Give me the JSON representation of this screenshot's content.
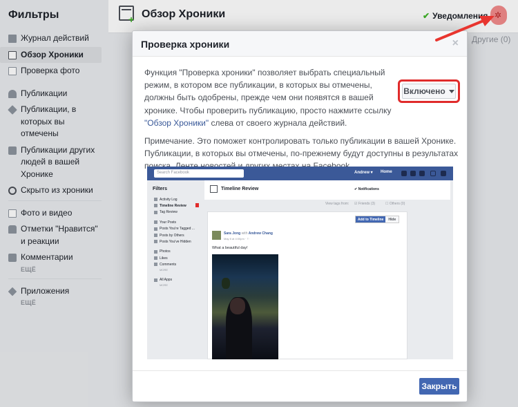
{
  "sidebar": {
    "title": "Фильтры",
    "items": [
      {
        "label": "Журнал действий",
        "icon": "journal-icon",
        "color": "#8d949e"
      },
      {
        "label": "Обзор Хроники",
        "icon": "timeline-review-icon",
        "color": "#4b4f56",
        "active": true
      },
      {
        "label": "Проверка фото",
        "icon": "photo-review-icon",
        "color": "#8d949e"
      },
      {
        "label": "Публикации",
        "icon": "person-icon",
        "color": "#8d949e"
      },
      {
        "label": "Публикации, в которых вы отмечены",
        "icon": "tag-icon",
        "color": "#8d949e"
      },
      {
        "label": "Публикации других людей в вашей Хронике",
        "icon": "comment-icon",
        "color": "#8d949e"
      },
      {
        "label": "Скрыто из хроники",
        "icon": "hidden-icon",
        "color": "#4b4f56"
      },
      {
        "label": "Фото и видео",
        "icon": "photos-icon",
        "color": "#8d949e"
      },
      {
        "label": "Отметки \"Нравится\" и реакции",
        "icon": "like-icon",
        "color": "#8d949e"
      },
      {
        "label": "Комментарии",
        "icon": "comments-icon",
        "color": "#8d949e"
      },
      {
        "label": "Приложения",
        "icon": "apps-icon",
        "color": "#8d949e"
      }
    ],
    "more_label": "ЕЩЁ"
  },
  "header": {
    "title": "Обзор Хроники",
    "notifications_label": "Уведомления",
    "other_label": "Другие (0)"
  },
  "dialog": {
    "title": "Проверка хроники",
    "close_glyph": "×",
    "paragraph1_before_link": "Функция \"Проверка хроники\" позволяет выбрать специальный режим, в котором все публикации, в которых вы отмечены, должны быть одобрены, прежде чем они появятся в вашей хронике. Чтобы проверить публикацию, просто нажмите ссылку ",
    "paragraph1_link": "\"Обзор Хроники\"",
    "paragraph1_after_link": " слева от своего журнала действий.",
    "paragraph2": "Примечание. Это поможет контролировать только публикации в вашей Хронике. Публикации, в которых вы отмечены, по-прежнему будут доступны в результатах поиска, Ленте новостей и других местах на Facebook.",
    "toggle_label": "Включено",
    "close_button": "Закрыть"
  },
  "example_screenshot": {
    "search_placeholder": "Search Facebook",
    "user": "Andrew ▾",
    "home": "Home",
    "filters_title": "Filters",
    "filters": [
      {
        "label": "Activity Log",
        "bold": false
      },
      {
        "label": "Timeline Review",
        "bold": true
      },
      {
        "label": "Tag Review",
        "bold": false
      },
      {
        "label": "Your Posts",
        "bold": false
      },
      {
        "label": "Posts You're Tagged ...",
        "bold": false
      },
      {
        "label": "Posts by Others",
        "bold": false
      },
      {
        "label": "Posts You've Hidden",
        "bold": false
      },
      {
        "label": "Photos",
        "bold": false
      },
      {
        "label": "Likes",
        "bold": false
      },
      {
        "label": "Comments",
        "bold": false
      },
      {
        "label": "All Apps",
        "bold": false
      }
    ],
    "more_label": "MORE",
    "header_title": "Timeline Review",
    "notifications": "✔ Notifications",
    "view_tags_from": "View tags from:",
    "friends_filter": "☑ Friends (3)",
    "others_filter": "☐ Others (0)",
    "add_to_timeline": "Add to Timeline",
    "hide": "Hide",
    "post_author": "Sara Jong",
    "post_with": "with",
    "post_tagged": "Andrew Chang",
    "post_date": "May 8 at 4:00pm · ⚐",
    "post_text": "What a beautiful day!"
  },
  "colors": {
    "fb_blue": "#4267b2",
    "highlight_red": "#e02b2b",
    "arrow_red": "#e8352f"
  }
}
